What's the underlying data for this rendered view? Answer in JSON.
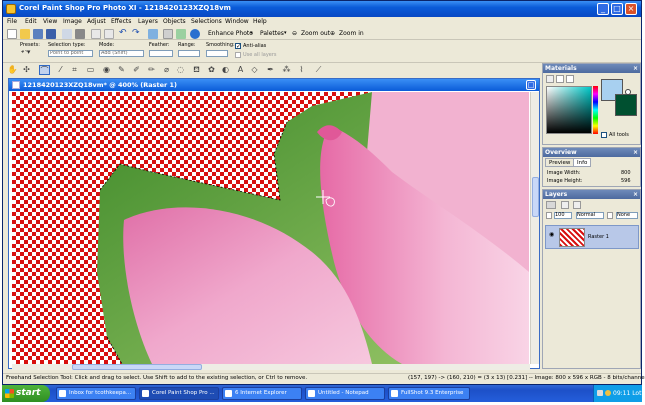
{
  "window": {
    "title": "Corel Paint Shop Pro Photo XI - 1218420123XZQ18vm",
    "min": "_",
    "max": "□",
    "close": "×"
  },
  "menu": [
    "File",
    "Edit",
    "View",
    "Image",
    "Adjust",
    "Effects",
    "Layers",
    "Objects",
    "Selections",
    "Window",
    "Help"
  ],
  "toolbar": {
    "enhance_photo": "Enhance Photo",
    "palettes": "Palettes",
    "zoom_out": "Zoom out",
    "zoom_in": "Zoom in"
  },
  "tool_options": {
    "presets_label": "Presets:",
    "selection_type_label": "Selection type:",
    "selection_type_value": "Point to point",
    "mode_label": "Mode:",
    "mode_value": "Add (Shift)",
    "feather_label": "Feather:",
    "range_label": "Range:",
    "smoothing_label": "Smoothing:",
    "antialias_label": "Anti-alias",
    "use_all_layers_label": "Use all layers"
  },
  "document": {
    "title": "1218420123XZQ18vm* @ 400% (Raster 1)"
  },
  "palettes": {
    "materials_title": "Materials",
    "all_tools_label": "All tools",
    "overview_title": "Overview",
    "tab_preview": "Preview",
    "tab_info": "Info",
    "image_width_label": "Image Width:",
    "image_width_value": "800",
    "image_height_label": "Image Height:",
    "image_height_value": "596",
    "layers_title": "Layers",
    "opacity_value": "100",
    "blend_value": "Normal",
    "none_value": "None",
    "layer_name": "Raster 1",
    "colors": {
      "foreground": "#a8d0f0",
      "background": "#005030"
    }
  },
  "status": {
    "hint": "Freehand Selection Tool: Click and drag to select. Use Shift to add to the existing selection, or Ctrl to remove.",
    "coords": "(157, 197) -> (160, 210) = (3 x 13) [0.231] -- Image: 800 x 596 x RGB - 8 bits/channel"
  },
  "taskbar": {
    "start": "start",
    "tasks": [
      "Inbox for tcothkeepa...",
      "Corel Paint Shop Pro ...",
      "6 Internet Explorer",
      "Untitled - Notepad",
      "FullShot 9.3 Enterprise"
    ],
    "clock": "09:11 Lot"
  }
}
